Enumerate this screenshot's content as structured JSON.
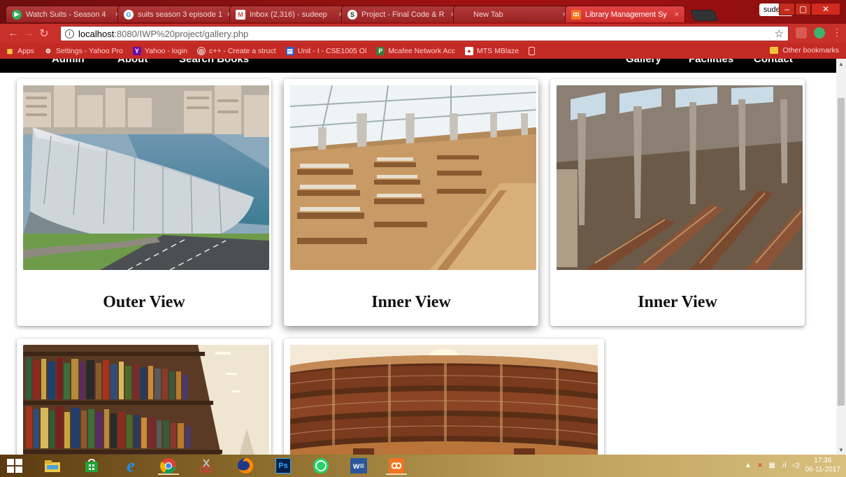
{
  "browser": {
    "tabs": [
      {
        "label": "Watch Suits - Season 4",
        "favicon": "play-icon",
        "color": "#2fae5a"
      },
      {
        "label": "suits season 3 episode 1",
        "favicon": "google-icon",
        "color": "#ffffff"
      },
      {
        "label": "Inbox (2,316) - sudeep",
        "favicon": "gmail-icon",
        "color": "#ffffff"
      },
      {
        "label": "Project - Final Code & R",
        "favicon": "s-icon",
        "color": "#ffffff"
      },
      {
        "label": "New Tab",
        "favicon": "",
        "color": ""
      },
      {
        "label": "Library Management Sy",
        "favicon": "xampp-icon",
        "color": "#f37321"
      }
    ],
    "user": "sudeep",
    "window_controls": {
      "minimize": "–",
      "maximize": "▢",
      "close": "✕"
    },
    "address": {
      "host": "localhost",
      "path": ":8080/IWP%20project/gallery.php"
    },
    "bookmarks": [
      {
        "label": "Apps",
        "icon": "apps-grid-icon"
      },
      {
        "label": "Settings - Yahoo Pro",
        "icon": "gear-icon"
      },
      {
        "label": "Yahoo - login",
        "icon": "yahoo-icon"
      },
      {
        "label": "c++ - Create a struct",
        "icon": "stackoverflow-icon"
      },
      {
        "label": "Unit - I - CSE1005 Ol",
        "icon": "doc-icon"
      },
      {
        "label": "Mcafee Network Acc",
        "icon": "mcafee-icon"
      },
      {
        "label": "MTS MBlaze",
        "icon": "mts-icon"
      },
      {
        "label": "",
        "icon": "blank-page-icon"
      }
    ],
    "other_bookmarks": "Other bookmarks"
  },
  "site_nav": {
    "left": [
      "Admin",
      "About",
      "Search Books"
    ],
    "right": [
      "Gallery",
      "Facilities",
      "Contact"
    ]
  },
  "gallery": {
    "cards": [
      {
        "caption": "Outer View",
        "image": "library-exterior-photo"
      },
      {
        "caption": "Inner View",
        "image": "library-reading-hall-photo"
      },
      {
        "caption": "Inner View",
        "image": "library-stacks-photo"
      },
      {
        "caption": "",
        "image": "bookshelf-aisle-photo"
      },
      {
        "caption": "",
        "image": "circular-library-photo"
      }
    ]
  },
  "taskbar": {
    "apps": [
      "windows-start-icon",
      "file-explorer-icon",
      "store-icon",
      "ie-icon",
      "chrome-icon",
      "snipping-tool-icon",
      "firefox-icon",
      "photoshop-icon",
      "whatsapp-icon",
      "word-icon",
      "xampp-icon"
    ],
    "time": "17:36",
    "date": "06-11-2017"
  }
}
